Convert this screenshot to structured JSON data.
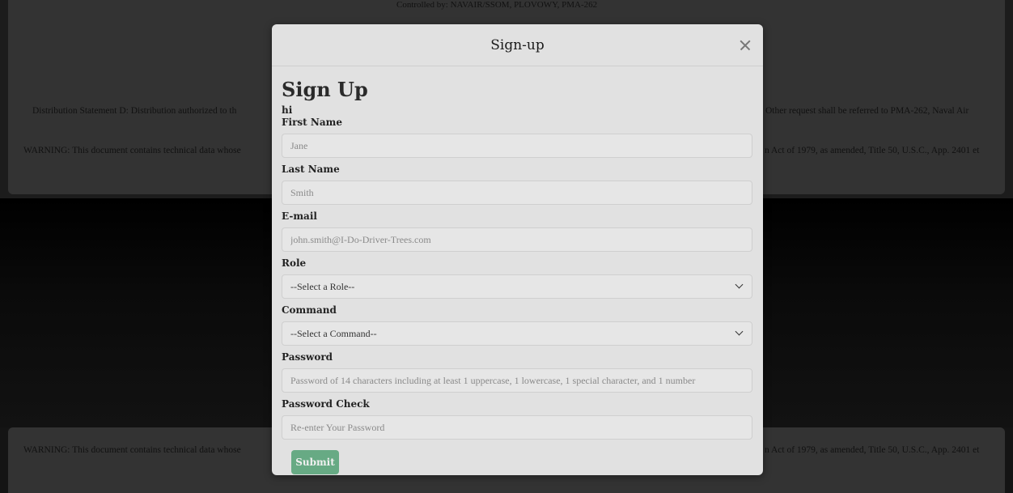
{
  "background": {
    "controlled_by": "Controlled by: NAVAIR/SSOM, PLOVOWY, PMA-262",
    "distribution_left": "Distribution Statement D: Distribution authorized to th",
    "distribution_right": "Other request shall be referred to PMA-262, Naval Air",
    "warning_left": "WARNING: This document contains technical data whose",
    "warning_right": "n Act of 1979, as amended, Title 50, U.S.C., App. 2401 et",
    "warning2_left": "WARNING: This document contains technical data whose",
    "warning2_right": "n Act of 1979, as amended, Title 50, U.S.C., App. 2401 et"
  },
  "modal": {
    "title": "Sign-up",
    "heading": "Sign Up",
    "hi": "hi",
    "fields": {
      "first_name": {
        "label": "First Name",
        "placeholder": "Jane"
      },
      "last_name": {
        "label": "Last Name",
        "placeholder": "Smith"
      },
      "email": {
        "label": "E-mail",
        "placeholder": "john.smith@I-Do-Driver-Trees.com"
      },
      "role": {
        "label": "Role",
        "selected": "--Select a Role--"
      },
      "command": {
        "label": "Command",
        "selected": "--Select a Command--"
      },
      "password": {
        "label": "Password",
        "placeholder": "Password of 14 characters including at least 1 uppercase, 1 lowercase, 1 special character, and 1 number"
      },
      "password_check": {
        "label": "Password Check",
        "placeholder": "Re-enter Your Password"
      }
    },
    "submit_label": "Submit"
  },
  "colors": {
    "submit_button": "#5aa57a",
    "modal_background": "#e1e1e1",
    "overlay_card": "#333333"
  }
}
